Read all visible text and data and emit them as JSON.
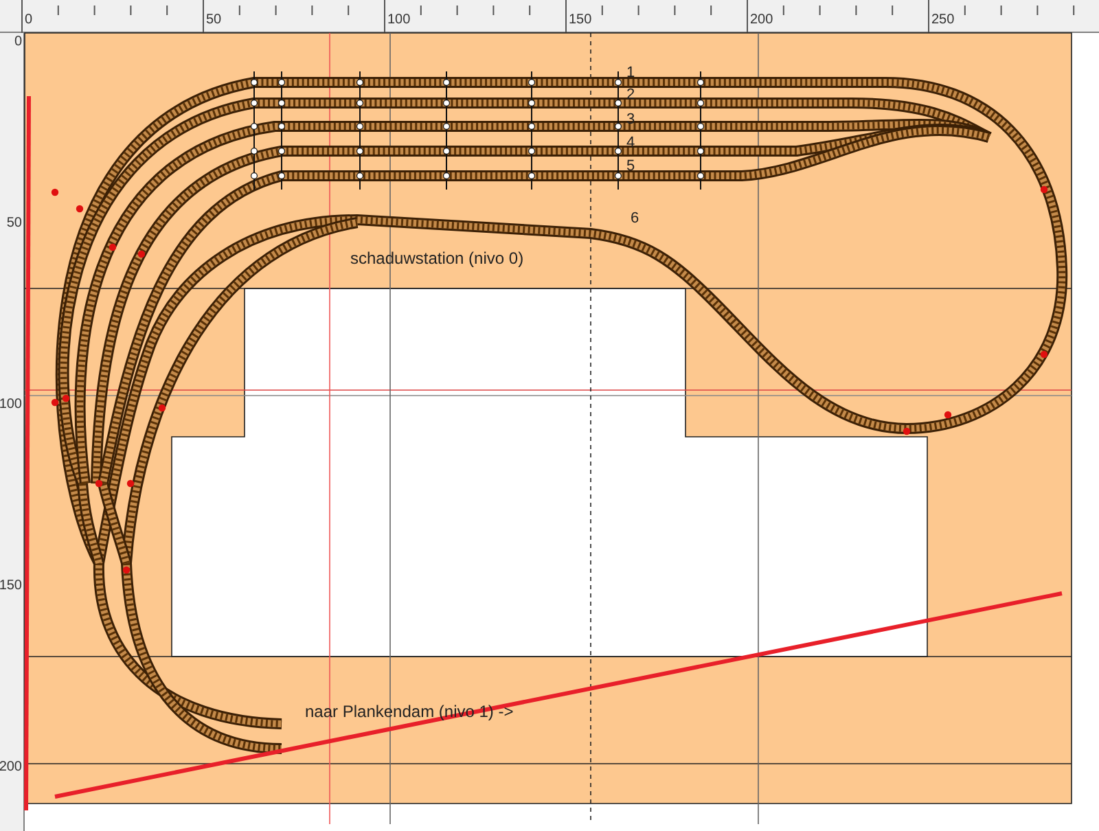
{
  "ruler_top": {
    "labels": [
      "0",
      "50",
      "100",
      "150",
      "200",
      "250"
    ]
  },
  "ruler_left": {
    "labels": [
      "0",
      "50",
      "100",
      "150",
      "200"
    ]
  },
  "layout": {
    "track_numbers": [
      "1",
      "2",
      "3",
      "4",
      "5",
      "6"
    ],
    "labels": [
      "schaduwstation (nivo 0)",
      "naar Plankendam (nivo 1) ->"
    ]
  }
}
